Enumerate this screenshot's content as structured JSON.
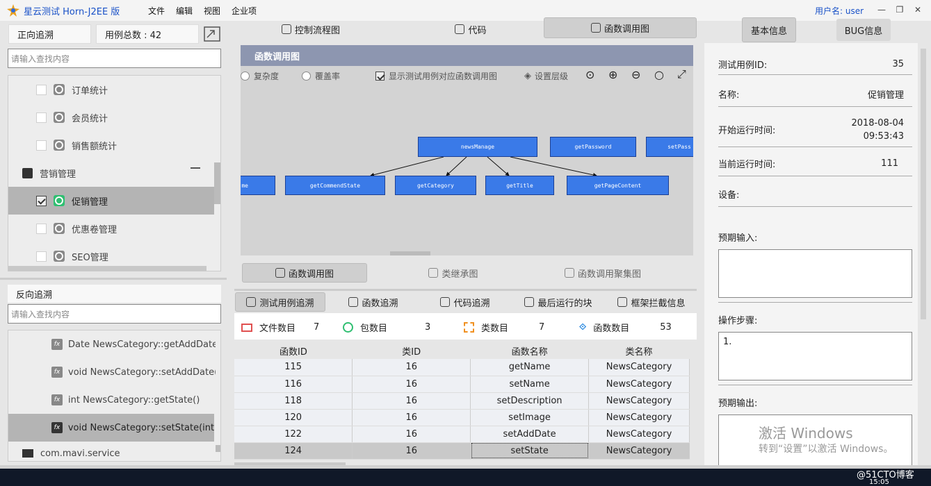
{
  "app": {
    "title": "星云测试 Horn-J2EE 版",
    "menu": [
      "文件",
      "编辑",
      "视图",
      "企业项"
    ],
    "user_label": "用户名: user"
  },
  "left": {
    "forward_label": "正向追溯",
    "case_count_label": "用例总数 : 42",
    "search_placeholder": "请输入查找内容",
    "tree": [
      {
        "label": "订单统计",
        "checked": false
      },
      {
        "label": "会员统计",
        "checked": false
      },
      {
        "label": "销售额统计",
        "checked": false
      },
      {
        "label": "营销管理",
        "group": true
      },
      {
        "label": "促销管理",
        "checked": true
      },
      {
        "label": "优惠卷管理",
        "checked": false
      },
      {
        "label": "SEO管理",
        "checked": false
      }
    ],
    "reverse_label": "反向追溯",
    "search2_placeholder": "请输入查找内容",
    "funcs": [
      "Date NewsCategory::getAddDate()",
      "void NewsCategory::setAddDate(D",
      "int NewsCategory::getState()",
      "void NewsCategory::setState(int)"
    ],
    "service_label": "com.mavi.service"
  },
  "middle": {
    "top_tabs": [
      "控制流程图",
      "代码",
      "函数调用图"
    ],
    "graph_title": "函数调用图",
    "options": [
      "复杂度",
      "覆盖率",
      "显示测试用例对应函数调用图",
      "设置层级"
    ],
    "nodes": [
      "newsManage",
      "getPassword",
      "setPass",
      "me",
      "getCommendState",
      "getCategory",
      "getTitle",
      "getPageContent"
    ],
    "sub_tabs": [
      "函数调用图",
      "类继承图",
      "函数调用聚集图"
    ],
    "trace_tabs": [
      "测试用例追溯",
      "函数追溯",
      "代码追溯",
      "最后运行的块",
      "框架拦截信息"
    ],
    "stats": [
      {
        "label": "文件数目",
        "value": "7"
      },
      {
        "label": "包数目",
        "value": "3"
      },
      {
        "label": "类数目",
        "value": "7"
      },
      {
        "label": "函数数目",
        "value": "53"
      }
    ],
    "table": {
      "headers": [
        "函数ID",
        "类ID",
        "函数名称",
        "类名称"
      ],
      "rows": [
        [
          "115",
          "16",
          "getName",
          "NewsCategory"
        ],
        [
          "116",
          "16",
          "setName",
          "NewsCategory"
        ],
        [
          "118",
          "16",
          "setDescription",
          "NewsCategory"
        ],
        [
          "120",
          "16",
          "setImage",
          "NewsCategory"
        ],
        [
          "122",
          "16",
          "setAddDate",
          "NewsCategory"
        ],
        [
          "124",
          "16",
          "setState",
          "NewsCategory"
        ]
      ]
    }
  },
  "right": {
    "tabs": [
      "基本信息",
      "BUG信息"
    ],
    "fields": [
      {
        "label": "测试用例ID:",
        "value": "35"
      },
      {
        "label": "名称:",
        "value": "促销管理"
      },
      {
        "label": "开始运行时间:",
        "value": "2018-08-04 09:53:43"
      },
      {
        "label": "当前运行时间:",
        "value": "111"
      },
      {
        "label": "设备:",
        "value": ""
      }
    ],
    "expected_input_label": "预期输入:",
    "steps_label": "操作步骤:",
    "steps_value": "1.",
    "expected_output_label": "预期输出:",
    "watermark_line1": "激活 Windows",
    "watermark_line2": "转到“设置”以激活 Windows。"
  },
  "taskbar": {
    "time": "15:05",
    "site": "@51CTO博客"
  },
  "colors": {
    "accent": "#1a52c8",
    "node": "#3a7ae8",
    "header": "#8d96b0"
  }
}
